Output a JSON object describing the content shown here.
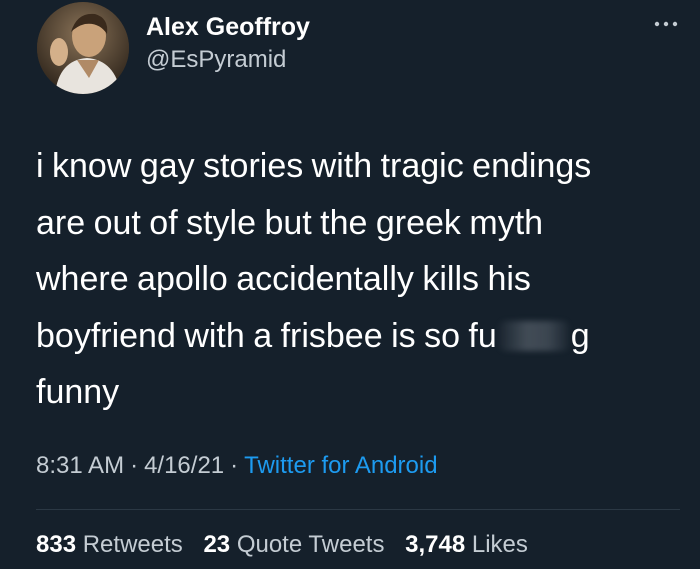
{
  "author": {
    "display_name": "Alex Geoffroy",
    "handle": "@EsPyramid"
  },
  "more_icon": "more-horizontal-icon",
  "tweet": {
    "lines": [
      "i know gay stories with tragic endings",
      "are out of style but the greek myth",
      "where apollo accidentally kills his",
      "boyfriend with a frisbee is so fu",
      "g",
      "funny"
    ]
  },
  "meta": {
    "time": "8:31 AM",
    "date": "4/16/21",
    "separator": "·",
    "source": "Twitter for Android"
  },
  "stats": {
    "retweets_count": "833",
    "retweets_label": "Retweets",
    "quotes_count": "23",
    "quotes_label": "Quote Tweets",
    "likes_count": "3,748",
    "likes_label": "Likes"
  },
  "colors": {
    "background": "#15202b",
    "text": "#ffffff",
    "secondary": "#c4ccd3",
    "link": "#1d9bf0"
  }
}
